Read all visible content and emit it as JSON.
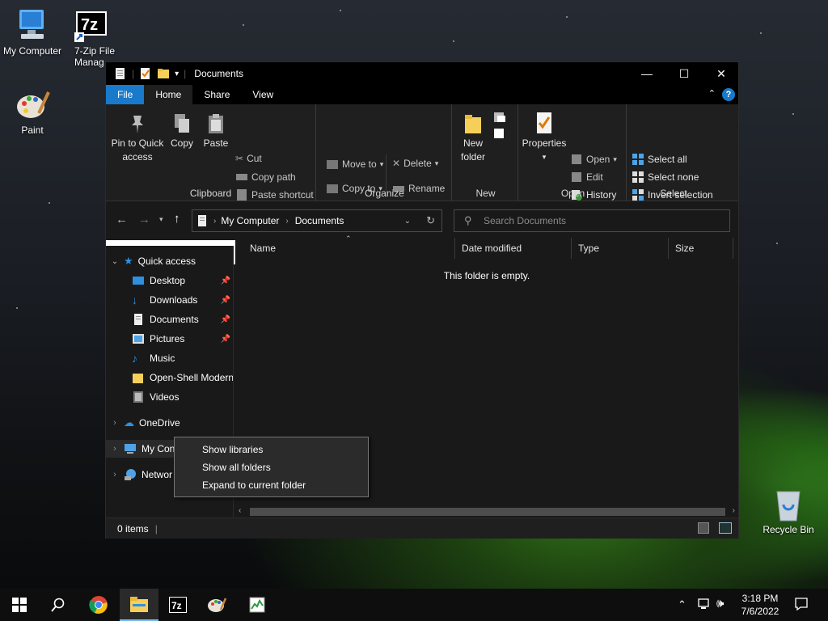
{
  "desktop": {
    "icons": [
      {
        "label": "My Computer",
        "icon": "computer-icon"
      },
      {
        "label": "7-Zip File Manag",
        "icon": "7zip-icon"
      },
      {
        "label": "Paint",
        "icon": "paint-icon"
      },
      {
        "label": "Recycle Bin",
        "icon": "recycle-bin-icon"
      }
    ]
  },
  "window": {
    "title": "Documents",
    "tabs": [
      "File",
      "Home",
      "Share",
      "View"
    ],
    "ribbon": {
      "clipboard": {
        "label": "Clipboard",
        "pin": "Pin to Quick access",
        "pin_l1": "Pin to Quick",
        "pin_l2": "access",
        "copy": "Copy",
        "paste": "Paste",
        "cut": "Cut",
        "copy_path": "Copy path",
        "paste_shortcut": "Paste shortcut"
      },
      "organize": {
        "label": "Organize",
        "move_to": "Move to",
        "copy_to": "Copy to",
        "delete": "Delete",
        "rename": "Rename"
      },
      "new": {
        "label": "New",
        "new_l1": "New",
        "new_l2": "folder"
      },
      "open": {
        "label": "Open",
        "properties": "Properties",
        "open": "Open",
        "edit": "Edit",
        "history": "History"
      },
      "select": {
        "label": "Select",
        "select_all": "Select all",
        "select_none": "Select none",
        "invert": "Invert selection"
      }
    },
    "address": {
      "segments": [
        "My Computer",
        "Documents"
      ]
    },
    "search_placeholder": "Search Documents",
    "nav": {
      "quick_access": "Quick access",
      "items": [
        "Desktop",
        "Downloads",
        "Documents",
        "Pictures",
        "Music",
        "Open-Shell Modern",
        "Videos"
      ],
      "onedrive": "OneDrive",
      "my_computer": "My Con",
      "network": "Networ"
    },
    "columns": [
      "Name",
      "Date modified",
      "Type",
      "Size"
    ],
    "empty_message": "This folder is empty.",
    "status": "0 items"
  },
  "context_menu": {
    "items": [
      "Show libraries",
      "Show all folders",
      "Expand to current folder"
    ]
  },
  "taskbar": {
    "time": "3:18 PM",
    "date": "7/6/2022"
  },
  "colors": {
    "accent": "#1979ca",
    "window_bg": "#191919",
    "ribbon_bg": "#1f1f1f"
  }
}
